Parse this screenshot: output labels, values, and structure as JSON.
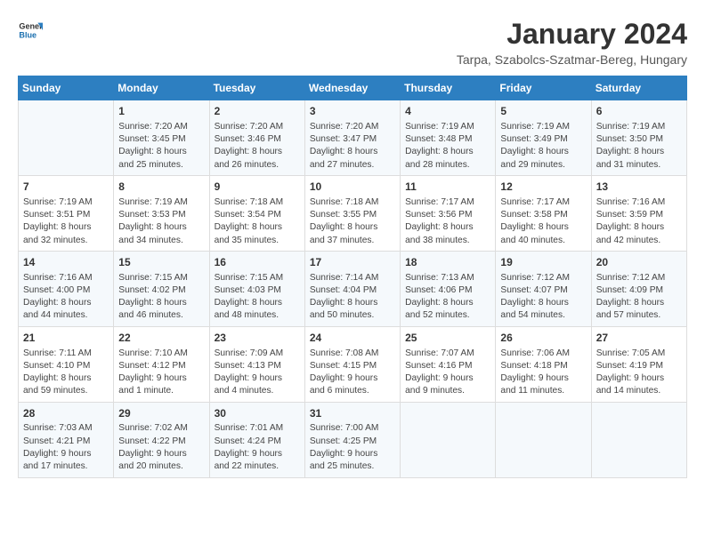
{
  "header": {
    "logo_general": "General",
    "logo_blue": "Blue",
    "title": "January 2024",
    "subtitle": "Tarpa, Szabolcs-Szatmar-Bereg, Hungary"
  },
  "columns": [
    "Sunday",
    "Monday",
    "Tuesday",
    "Wednesday",
    "Thursday",
    "Friday",
    "Saturday"
  ],
  "weeks": [
    [
      {
        "day": "",
        "content": ""
      },
      {
        "day": "1",
        "content": "Sunrise: 7:20 AM\nSunset: 3:45 PM\nDaylight: 8 hours\nand 25 minutes."
      },
      {
        "day": "2",
        "content": "Sunrise: 7:20 AM\nSunset: 3:46 PM\nDaylight: 8 hours\nand 26 minutes."
      },
      {
        "day": "3",
        "content": "Sunrise: 7:20 AM\nSunset: 3:47 PM\nDaylight: 8 hours\nand 27 minutes."
      },
      {
        "day": "4",
        "content": "Sunrise: 7:19 AM\nSunset: 3:48 PM\nDaylight: 8 hours\nand 28 minutes."
      },
      {
        "day": "5",
        "content": "Sunrise: 7:19 AM\nSunset: 3:49 PM\nDaylight: 8 hours\nand 29 minutes."
      },
      {
        "day": "6",
        "content": "Sunrise: 7:19 AM\nSunset: 3:50 PM\nDaylight: 8 hours\nand 31 minutes."
      }
    ],
    [
      {
        "day": "7",
        "content": "Sunrise: 7:19 AM\nSunset: 3:51 PM\nDaylight: 8 hours\nand 32 minutes."
      },
      {
        "day": "8",
        "content": "Sunrise: 7:19 AM\nSunset: 3:53 PM\nDaylight: 8 hours\nand 34 minutes."
      },
      {
        "day": "9",
        "content": "Sunrise: 7:18 AM\nSunset: 3:54 PM\nDaylight: 8 hours\nand 35 minutes."
      },
      {
        "day": "10",
        "content": "Sunrise: 7:18 AM\nSunset: 3:55 PM\nDaylight: 8 hours\nand 37 minutes."
      },
      {
        "day": "11",
        "content": "Sunrise: 7:17 AM\nSunset: 3:56 PM\nDaylight: 8 hours\nand 38 minutes."
      },
      {
        "day": "12",
        "content": "Sunrise: 7:17 AM\nSunset: 3:58 PM\nDaylight: 8 hours\nand 40 minutes."
      },
      {
        "day": "13",
        "content": "Sunrise: 7:16 AM\nSunset: 3:59 PM\nDaylight: 8 hours\nand 42 minutes."
      }
    ],
    [
      {
        "day": "14",
        "content": "Sunrise: 7:16 AM\nSunset: 4:00 PM\nDaylight: 8 hours\nand 44 minutes."
      },
      {
        "day": "15",
        "content": "Sunrise: 7:15 AM\nSunset: 4:02 PM\nDaylight: 8 hours\nand 46 minutes."
      },
      {
        "day": "16",
        "content": "Sunrise: 7:15 AM\nSunset: 4:03 PM\nDaylight: 8 hours\nand 48 minutes."
      },
      {
        "day": "17",
        "content": "Sunrise: 7:14 AM\nSunset: 4:04 PM\nDaylight: 8 hours\nand 50 minutes."
      },
      {
        "day": "18",
        "content": "Sunrise: 7:13 AM\nSunset: 4:06 PM\nDaylight: 8 hours\nand 52 minutes."
      },
      {
        "day": "19",
        "content": "Sunrise: 7:12 AM\nSunset: 4:07 PM\nDaylight: 8 hours\nand 54 minutes."
      },
      {
        "day": "20",
        "content": "Sunrise: 7:12 AM\nSunset: 4:09 PM\nDaylight: 8 hours\nand 57 minutes."
      }
    ],
    [
      {
        "day": "21",
        "content": "Sunrise: 7:11 AM\nSunset: 4:10 PM\nDaylight: 8 hours\nand 59 minutes."
      },
      {
        "day": "22",
        "content": "Sunrise: 7:10 AM\nSunset: 4:12 PM\nDaylight: 9 hours\nand 1 minute."
      },
      {
        "day": "23",
        "content": "Sunrise: 7:09 AM\nSunset: 4:13 PM\nDaylight: 9 hours\nand 4 minutes."
      },
      {
        "day": "24",
        "content": "Sunrise: 7:08 AM\nSunset: 4:15 PM\nDaylight: 9 hours\nand 6 minutes."
      },
      {
        "day": "25",
        "content": "Sunrise: 7:07 AM\nSunset: 4:16 PM\nDaylight: 9 hours\nand 9 minutes."
      },
      {
        "day": "26",
        "content": "Sunrise: 7:06 AM\nSunset: 4:18 PM\nDaylight: 9 hours\nand 11 minutes."
      },
      {
        "day": "27",
        "content": "Sunrise: 7:05 AM\nSunset: 4:19 PM\nDaylight: 9 hours\nand 14 minutes."
      }
    ],
    [
      {
        "day": "28",
        "content": "Sunrise: 7:03 AM\nSunset: 4:21 PM\nDaylight: 9 hours\nand 17 minutes."
      },
      {
        "day": "29",
        "content": "Sunrise: 7:02 AM\nSunset: 4:22 PM\nDaylight: 9 hours\nand 20 minutes."
      },
      {
        "day": "30",
        "content": "Sunrise: 7:01 AM\nSunset: 4:24 PM\nDaylight: 9 hours\nand 22 minutes."
      },
      {
        "day": "31",
        "content": "Sunrise: 7:00 AM\nSunset: 4:25 PM\nDaylight: 9 hours\nand 25 minutes."
      },
      {
        "day": "",
        "content": ""
      },
      {
        "day": "",
        "content": ""
      },
      {
        "day": "",
        "content": ""
      }
    ]
  ]
}
